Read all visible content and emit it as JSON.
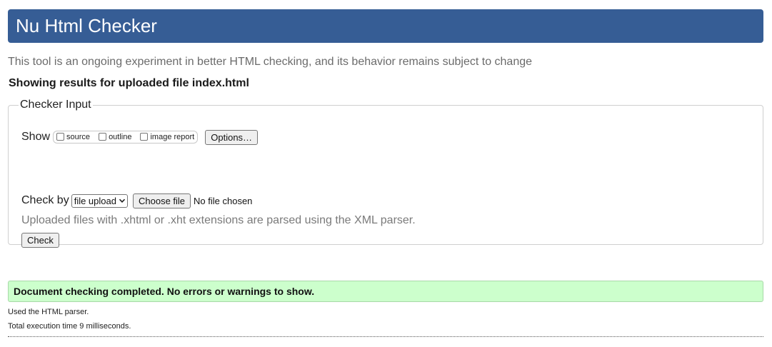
{
  "header": {
    "title": "Nu Html Checker"
  },
  "intro": {
    "subtitle": "This tool is an ongoing experiment in better HTML checking, and its behavior remains subject to change",
    "results_heading": "Showing results for uploaded file index.html"
  },
  "checker_input": {
    "legend": "Checker Input",
    "show_label": "Show",
    "show_options": [
      {
        "label": "source",
        "checked": false
      },
      {
        "label": "outline",
        "checked": false
      },
      {
        "label": "image report",
        "checked": false
      }
    ],
    "options_button": "Options…",
    "check_by_label": "Check by",
    "check_by_selected": "file upload",
    "choose_file_button": "Choose file",
    "file_status": "No file chosen",
    "xml_note": "Uploaded files with .xhtml or .xht extensions are parsed using the XML parser.",
    "check_button": "Check"
  },
  "result": {
    "message": "Document checking completed. No errors or warnings to show.",
    "parser_note": "Used the HTML parser.",
    "execution_time": "Total execution time 9 milliseconds."
  },
  "colors": {
    "header_bg": "#365d95",
    "success_bg": "#ccffcc"
  }
}
